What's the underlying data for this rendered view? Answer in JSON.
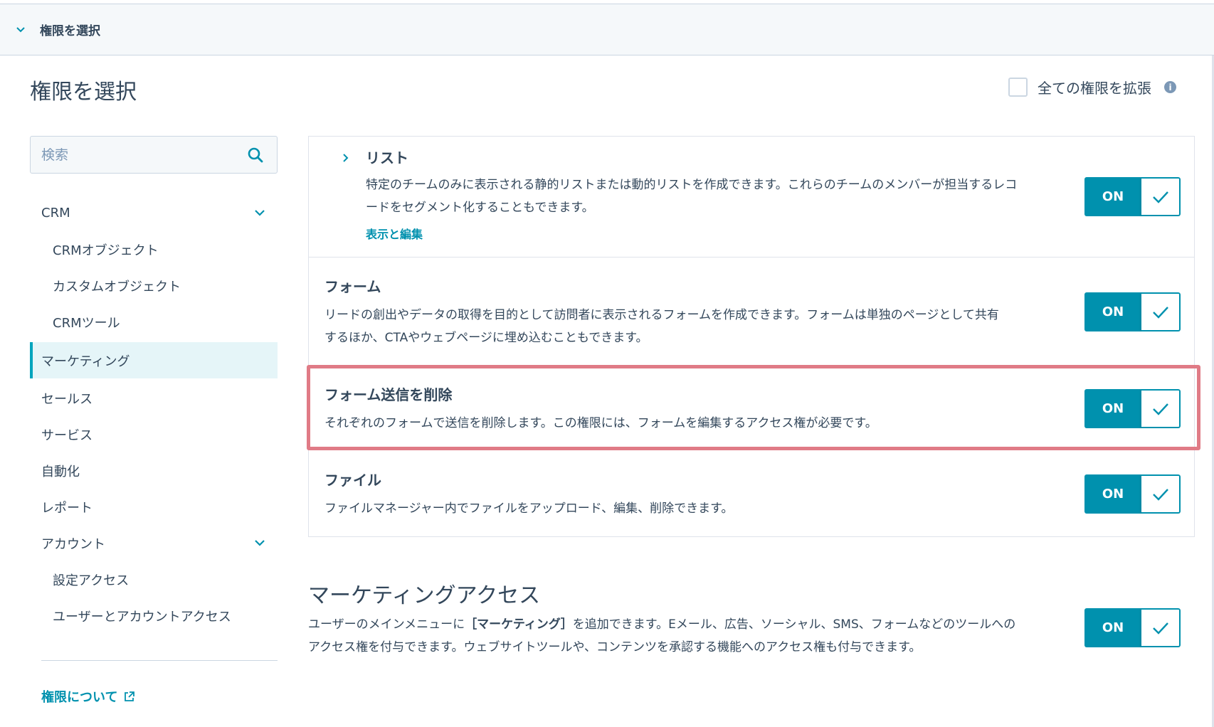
{
  "top_bar": {
    "label": "権限を選択"
  },
  "page_title": "権限を選択",
  "expand_all": {
    "label": "全ての権限を拡張",
    "checked": false,
    "info_glyph": "i"
  },
  "search": {
    "placeholder": "検索",
    "value": ""
  },
  "sidebar": {
    "items": [
      {
        "label": "CRM",
        "level": "top",
        "expanded": true
      },
      {
        "label": "CRMオブジェクト",
        "level": "sub"
      },
      {
        "label": "カスタムオブジェクト",
        "level": "sub"
      },
      {
        "label": "CRMツール",
        "level": "sub"
      },
      {
        "label": "マーケティング",
        "level": "top",
        "active": true
      },
      {
        "label": "セールス",
        "level": "top"
      },
      {
        "label": "サービス",
        "level": "top"
      },
      {
        "label": "自動化",
        "level": "top"
      },
      {
        "label": "レポート",
        "level": "top"
      },
      {
        "label": "アカウント",
        "level": "top",
        "expanded": true
      },
      {
        "label": "設定アクセス",
        "level": "sub"
      },
      {
        "label": "ユーザーとアカウントアクセス",
        "level": "sub"
      }
    ],
    "about_link": "権限について"
  },
  "permissions": [
    {
      "title": "リスト",
      "description": "特定のチームのみに表示される静的リストまたは動的リストを作成できます。これらのチームのメンバーが担当するレコードをセグメント化することもできます。",
      "link": "表示と編集",
      "toggle": "ON"
    },
    {
      "title": "フォーム",
      "description": "リードの創出やデータの取得を目的として訪問者に表示されるフォームを作成できます。フォームは単独のページとして共有するほか、CTAやウェブページに埋め込むこともできます。",
      "toggle": "ON"
    },
    {
      "title": "フォーム送信を削除",
      "description": "それぞれのフォームで送信を削除します。この権限には、フォームを編集するアクセス権が必要です。",
      "toggle": "ON",
      "highlighted": true
    },
    {
      "title": "ファイル",
      "description": "ファイルマネージャー内でファイルをアップロード、編集、削除できます。",
      "toggle": "ON"
    }
  ],
  "marketing_access": {
    "title": "マーケティングアクセス",
    "desc_before": "ユーザーのメインメニューに",
    "desc_bold": "［マーケティング］",
    "desc_after": "を追加できます。Eメール、広告、ソーシャル、SMS、フォームなどのツールへのアクセス権を付与できます。ウェブサイトツールや、コンテンツを承認する機能へのアクセス権も付与できます。",
    "toggle": "ON"
  },
  "colors": {
    "accent": "#0091ae",
    "text": "#33475b",
    "highlight_border": "#e07b86",
    "active_nav_bg": "#e5f5f8"
  }
}
